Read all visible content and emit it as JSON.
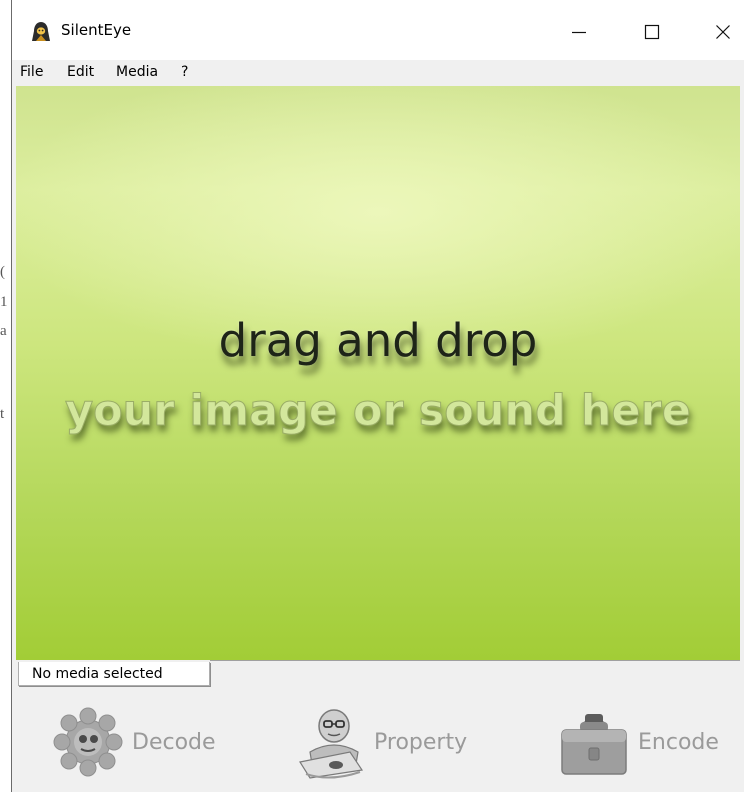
{
  "window": {
    "title": "SilentEye",
    "icon": "hooded-figure-icon",
    "controls": {
      "minimize": "—",
      "maximize": "☐",
      "close": "✕"
    }
  },
  "menubar": {
    "items": [
      "File",
      "Edit",
      "Media",
      "?"
    ]
  },
  "drop_area": {
    "line1": "drag and drop",
    "line2": "your image or sound here"
  },
  "status": {
    "text": "No media selected"
  },
  "actions": {
    "decode": {
      "label": "Decode",
      "icon": "gear-badge-icon"
    },
    "property": {
      "label": "Property",
      "icon": "person-at-desk-icon"
    },
    "encode": {
      "label": "Encode",
      "icon": "briefcase-icon"
    }
  },
  "background_window": {
    "edge_chars": [
      "(",
      "1",
      "a",
      "t"
    ]
  },
  "colors": {
    "drop_top": "#dcee9e",
    "drop_bottom": "#a2cd36",
    "label_gray": "#9a9a9a",
    "chrome": "#f0f0f0"
  }
}
